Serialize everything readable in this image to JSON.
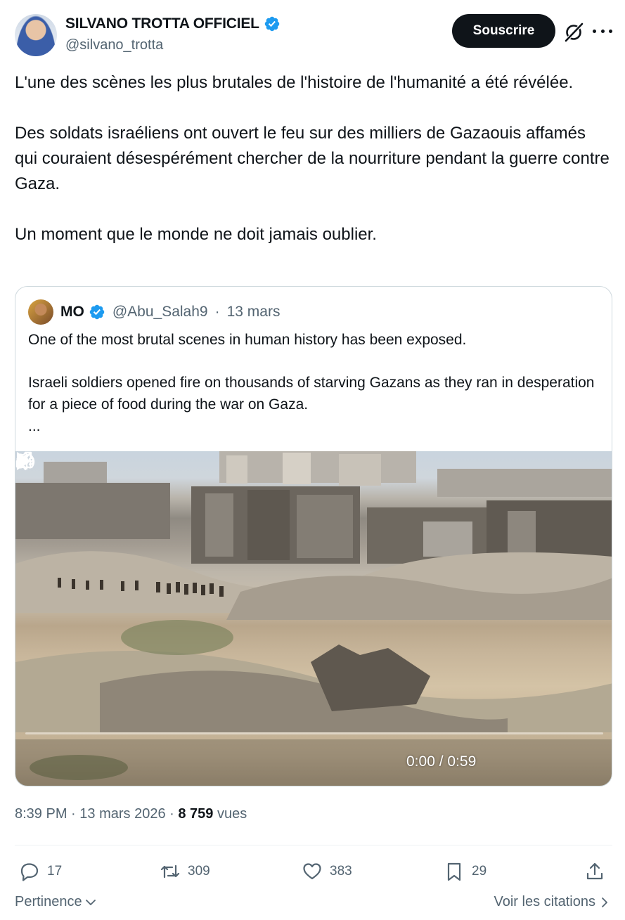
{
  "author": {
    "display_name": "SILVANO TROTTA OFFICIEL",
    "handle": "@silvano_trotta",
    "verified_icon": "verified-badge-icon"
  },
  "header": {
    "subscribe_label": "Souscrire",
    "grok_icon": "grok-icon",
    "more_icon": "more-icon"
  },
  "tweet": {
    "paragraphs": [
      "L'une des scènes les plus brutales de l'histoire de l'humanité a été révélée.",
      "Des soldats israéliens ont ouvert le feu sur des milliers de Gazaouis affamés qui couraient désespérément chercher de la nourriture pendant la guerre contre Gaza.",
      "Un moment que le monde ne doit jamais oublier."
    ]
  },
  "quote": {
    "name": "MO",
    "handle": "@Abu_Salah9",
    "separator": "·",
    "date": "13 mars",
    "paragraphs": [
      "One of the most brutal scenes in human history has been exposed.",
      "Israeli soldiers opened fire on thousands of starving Gazans as they ran in desperation for a piece of food during the war on Gaza.",
      "..."
    ],
    "video": {
      "time": "0:00 / 0:59",
      "progress": 0
    }
  },
  "meta": {
    "time": "8:39 PM",
    "sep": "·",
    "date": "13 mars 2026",
    "views_count": "8 759",
    "views_label": "vues"
  },
  "actions": {
    "replies": "17",
    "reposts": "309",
    "likes": "383",
    "bookmarks": "29"
  },
  "footer": {
    "relevance_label": "Pertinence",
    "quotes_label": "Voir les citations"
  },
  "colors": {
    "text": "#0f1419",
    "secondary": "#536471",
    "verified": "#1d9bf0",
    "border": "#cfd9de"
  }
}
